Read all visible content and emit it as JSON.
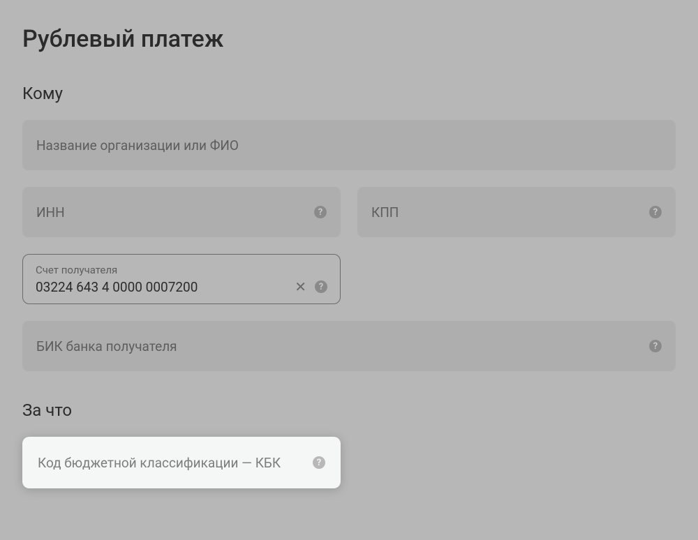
{
  "page": {
    "title": "Рублевый платеж"
  },
  "sections": {
    "to_whom": {
      "title": "Кому",
      "fields": {
        "org_name": {
          "placeholder": "Название организации или ФИО"
        },
        "inn": {
          "placeholder": "ИНН"
        },
        "kpp": {
          "placeholder": "КПП"
        },
        "account": {
          "label": "Счет получателя",
          "value": "03224 643 4 0000 0007200"
        },
        "bik": {
          "placeholder": "БИК банка получателя"
        }
      }
    },
    "for_what": {
      "title": "За что",
      "fields": {
        "kbk": {
          "placeholder": "Код бюджетной классификации — КБК"
        }
      }
    }
  }
}
